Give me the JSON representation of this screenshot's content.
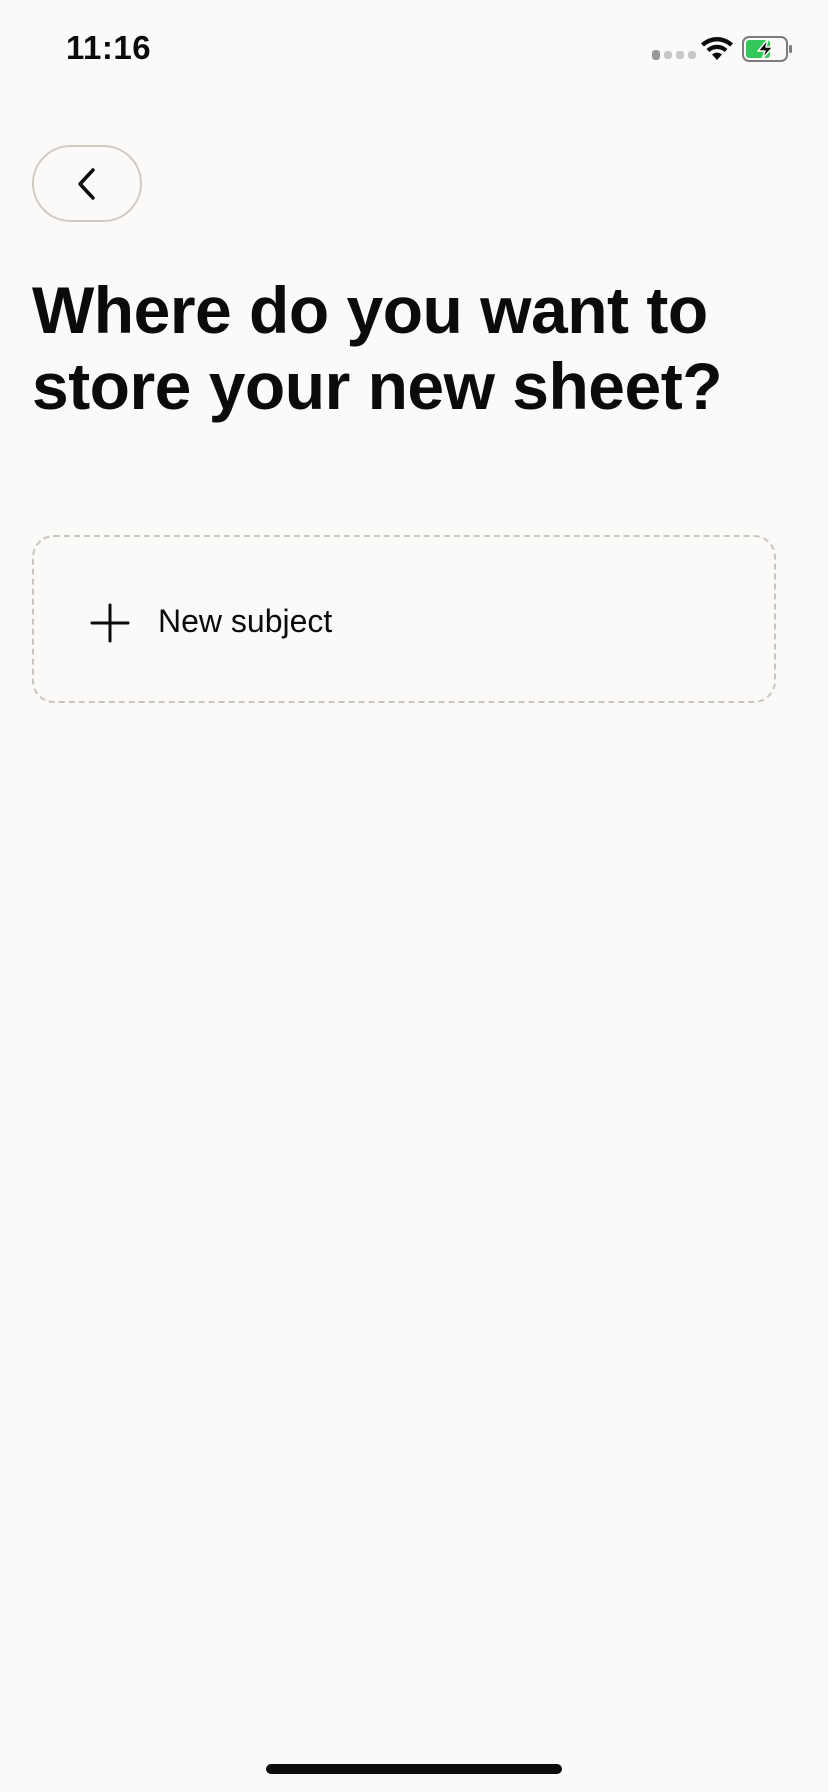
{
  "status_bar": {
    "time": "11:16",
    "signal_icon": "cellular-signal-icon",
    "wifi_icon": "wifi-icon",
    "battery_icon": "battery-charging-icon",
    "battery_color": "#34c759"
  },
  "header": {
    "back_icon": "chevron-left-icon"
  },
  "main": {
    "title": "Where do you want to store your new sheet?",
    "new_subject": {
      "icon": "plus-icon",
      "label": "New subject"
    }
  },
  "colors": {
    "background": "#fbfaf8",
    "text": "#0b0b0b",
    "border": "#cfcbc0"
  }
}
